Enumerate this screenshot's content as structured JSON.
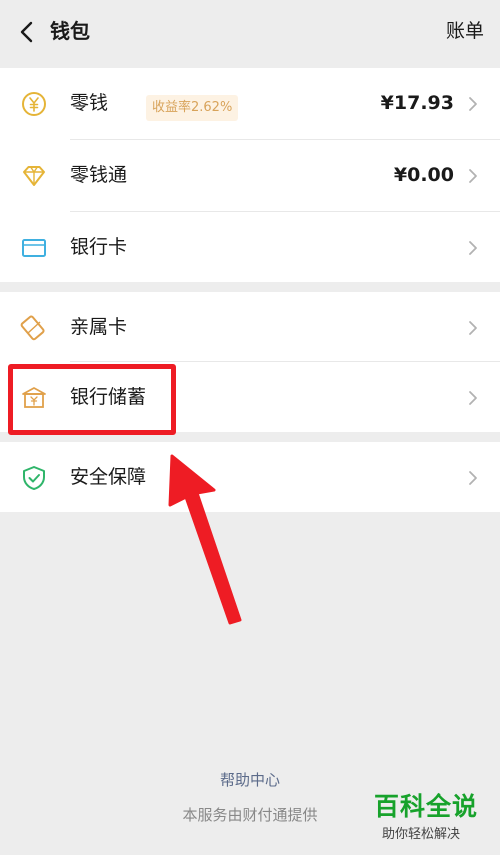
{
  "header": {
    "title": "钱包",
    "right_action": "账单"
  },
  "wallet_items": [
    {
      "label": "零钱",
      "value": "¥17.93",
      "icon": "yen-coin-icon"
    },
    {
      "label": "零钱通",
      "badge": "收益率2.62%",
      "value": "¥0.00",
      "icon": "diamond-icon"
    },
    {
      "label": "银行卡",
      "icon": "bank-card-icon"
    }
  ],
  "service_items": [
    {
      "label": "亲属卡",
      "icon": "family-card-icon"
    },
    {
      "label": "银行储蓄",
      "icon": "bank-savings-icon"
    }
  ],
  "security_items": [
    {
      "label": "安全保障",
      "icon": "shield-check-icon"
    }
  ],
  "footer": {
    "help_link": "帮助中心",
    "provided_by": "本服务由财付通提供"
  },
  "watermark": {
    "title": "百科全说",
    "subtitle": "助你轻松解决"
  },
  "colors": {
    "background": "#ededed",
    "highlight": "#ee1c24",
    "gold": "#e5b437",
    "blue": "#3fb0e0",
    "green": "#2fb56a",
    "watermark_green": "#17a22b"
  }
}
